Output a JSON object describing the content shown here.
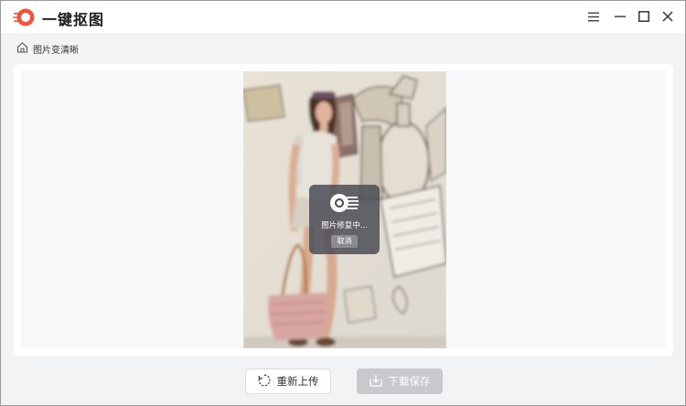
{
  "app": {
    "title": "一键抠图",
    "logo_icon": "app-logo-icon",
    "accent": "#f0533a"
  },
  "window_controls": {
    "menu_icon": "hamburger-menu-icon",
    "minimize_icon": "minimize-icon",
    "maximize_icon": "maximize-icon",
    "close_icon": "close-icon"
  },
  "breadcrumb": {
    "home_icon": "home-icon",
    "label": "图片变清晰"
  },
  "preview": {
    "image_description_icon": "photo-preview",
    "overlay": {
      "status_text": "图片修复中...",
      "cancel_label": "取消"
    }
  },
  "actions": {
    "reupload_label": "重新上传",
    "reupload_icon": "refresh-icon",
    "download_label": "下载保存",
    "download_icon": "download-icon"
  }
}
